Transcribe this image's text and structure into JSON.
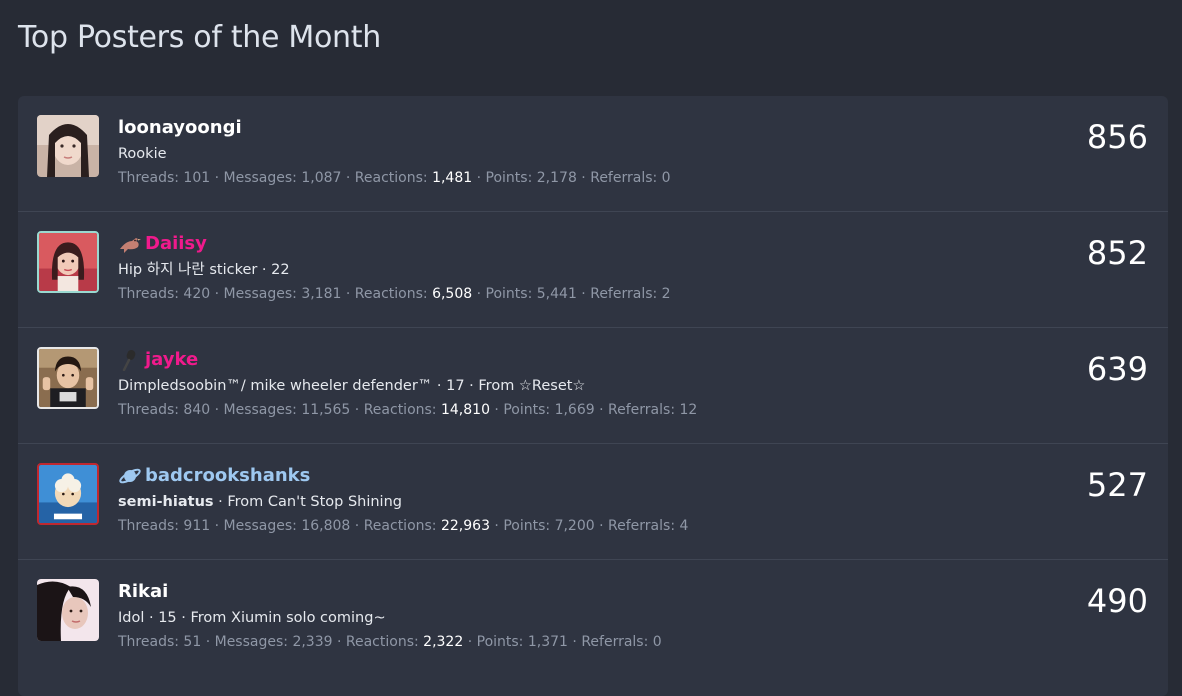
{
  "page": {
    "title": "Top Posters of the Month"
  },
  "colors": {
    "background": "#272b35",
    "panel": "#2f3441",
    "pink_username": "#f01a8c",
    "blue_username": "#9ec8f0",
    "white_username": "#ffffff",
    "stats_text": "#8f97a6"
  },
  "posters": [
    {
      "username": "loonayoongi",
      "username_color": "#ffffff",
      "icon": "",
      "title_parts": [
        "Rookie"
      ],
      "stats": {
        "threads_label": "Threads:",
        "threads": "101",
        "messages_label": "Messages:",
        "messages": "1,087",
        "reactions_label": "Reactions:",
        "reactions": "1,481",
        "points_label": "Points:",
        "points": "2,178",
        "referrals_label": "Referrals:",
        "referrals": "0"
      },
      "count": "856"
    },
    {
      "username": "Daiisy",
      "username_color": "#f01a8c",
      "icon": "bird-icon",
      "title_parts": [
        "Hip 하지 나란 sticker · 22"
      ],
      "stats": {
        "threads_label": "Threads:",
        "threads": "420",
        "messages_label": "Messages:",
        "messages": "3,181",
        "reactions_label": "Reactions:",
        "reactions": "6,508",
        "points_label": "Points:",
        "points": "5,441",
        "referrals_label": "Referrals:",
        "referrals": "2"
      },
      "count": "852"
    },
    {
      "username": "jayke",
      "username_color": "#f01a8c",
      "icon": "microphone-icon",
      "title_parts": [
        "Dimpledsoobin™/ mike wheeler defender™ · 17 · From ☆Reset☆"
      ],
      "stats": {
        "threads_label": "Threads:",
        "threads": "840",
        "messages_label": "Messages:",
        "messages": "11,565",
        "reactions_label": "Reactions:",
        "reactions": "14,810",
        "points_label": "Points:",
        "points": "1,669",
        "referrals_label": "Referrals:",
        "referrals": "12"
      },
      "count": "639"
    },
    {
      "username": "badcrookshanks",
      "username_color": "#9ec8f0",
      "icon": "planet-icon",
      "title_bold": "semi-hiatus",
      "title_rest": " · From Can't Stop Shining",
      "stats": {
        "threads_label": "Threads:",
        "threads": "911",
        "messages_label": "Messages:",
        "messages": "16,808",
        "reactions_label": "Reactions:",
        "reactions": "22,963",
        "points_label": "Points:",
        "points": "7,200",
        "referrals_label": "Referrals:",
        "referrals": "4"
      },
      "count": "527"
    },
    {
      "username": "Rikai",
      "username_color": "#ffffff",
      "icon": "",
      "title_parts": [
        "Idol · 15 · From Xiumin solo coming~"
      ],
      "stats": {
        "threads_label": "Threads:",
        "threads": "51",
        "messages_label": "Messages:",
        "messages": "2,339",
        "reactions_label": "Reactions:",
        "reactions": "2,322",
        "points_label": "Points:",
        "points": "1,371",
        "referrals_label": "Referrals:",
        "referrals": "0"
      },
      "count": "490"
    }
  ]
}
